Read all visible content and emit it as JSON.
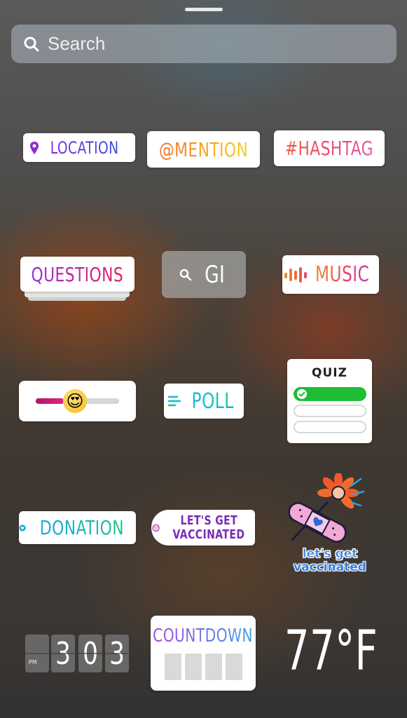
{
  "search": {
    "placeholder": "Search",
    "icon": "search-icon"
  },
  "stickers": {
    "location": {
      "label": "LOCATION",
      "icon": "location-pin-icon"
    },
    "mention": {
      "label": "@MENTION"
    },
    "hashtag": {
      "label": "#HASHTAG"
    },
    "questions": {
      "label": "QUESTIONS"
    },
    "gif": {
      "label": "GI",
      "icon": "search-icon"
    },
    "music": {
      "label": "MUSIC",
      "icon": "music-bars-icon"
    },
    "slider": {
      "emoji": "😍",
      "level": 0.34
    },
    "poll": {
      "label": "POLL",
      "icon": "poll-lines-icon"
    },
    "quiz": {
      "title": "QUIZ",
      "icon": "check-icon"
    },
    "donation": {
      "label": "DONATION",
      "icon": "heart-icon"
    },
    "vaccinated_badge": {
      "line1": "LET'S GET",
      "line2": "VACCINATED",
      "icon": "heart-badge-icon"
    },
    "vaccinated_art": {
      "line1": "let's get",
      "line2": "vaccinated"
    },
    "time": {
      "period": "PM",
      "digits": [
        "3",
        "0",
        "3"
      ]
    },
    "countdown": {
      "label": "COUNTDOWN"
    },
    "weather": {
      "label": "77°F"
    }
  },
  "colors": {
    "quiz_correct": "#1fbd35",
    "slider_track": "#c8186e",
    "vaccinated_purple": "#7b2bb5",
    "white": "#ffffff"
  }
}
